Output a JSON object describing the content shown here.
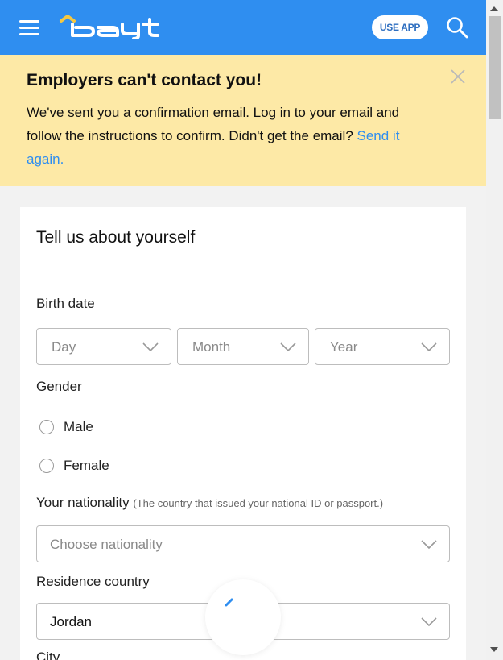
{
  "header": {
    "logo_text": "bayt",
    "use_app_label": "USE APP",
    "brand_color": "#2f8ef0"
  },
  "banner": {
    "title": "Employers can't contact you!",
    "message": "We've sent you a confirmation email. Log in to your email and follow the instructions to confirm. Didn't get the email? ",
    "link": "Send it again.",
    "background": "#fde9a6"
  },
  "form": {
    "title": "Tell us about yourself",
    "birth_date": {
      "label": "Birth date",
      "day_placeholder": "Day",
      "month_placeholder": "Month",
      "year_placeholder": "Year"
    },
    "gender": {
      "label": "Gender",
      "options": [
        "Male",
        "Female"
      ]
    },
    "nationality": {
      "label": "Your nationality",
      "hint": "(The country that issued your national ID or passport.)",
      "placeholder": "Choose nationality"
    },
    "residence": {
      "label": "Residence country",
      "value": "Jordan"
    },
    "city": {
      "label": "City"
    }
  }
}
